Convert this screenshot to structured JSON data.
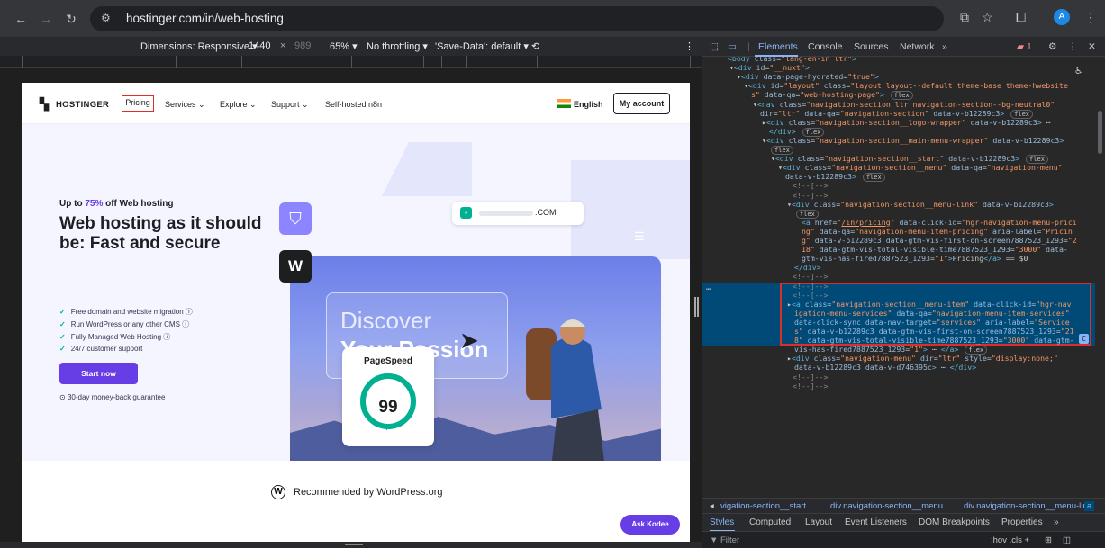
{
  "browser": {
    "url": "hostinger.com/in/web-hosting",
    "avatar_letter": "A"
  },
  "device_toolbar": {
    "dimensions_label": "Dimensions: Responsive ▾",
    "width": "1440",
    "times": "×",
    "height": "989",
    "zoom": "65% ▾",
    "throttle": "No throttling ▾",
    "save_data": "'Save-Data': default ▾"
  },
  "site": {
    "logo_text": "HOSTINGER",
    "nav": {
      "pricing": "Pricing",
      "services": "Services ⌄",
      "explore": "Explore ⌄",
      "support": "Support ⌄",
      "self_hosted": "Self-hosted n8n",
      "language": "English",
      "account": "My account"
    },
    "hero": {
      "offer_prefix": "Up to ",
      "offer_pct": "75%",
      "offer_suffix": " off Web hosting",
      "title": "Web hosting as it should be: Fast and secure",
      "features": [
        "Free domain and website migration ⓘ",
        "Run WordPress or any other CMS ⓘ",
        "Fully Managed Web Hosting ⓘ",
        "24/7 customer support"
      ],
      "cta": "Start now",
      "guarantee": "30-day money-back guarantee",
      "url_suffix": ".COM",
      "discover": "Discover",
      "passion": "Your Passion",
      "pagespeed_label": "PageSpeed",
      "pagespeed_score": "99"
    },
    "recommended": "Recommended by WordPress.org",
    "ask_kodee": "Ask Kodee"
  },
  "devtools": {
    "tabs": [
      "Elements",
      "Console",
      "Sources",
      "Network",
      "»"
    ],
    "issues_count": "1",
    "tree_lines": [
      {
        "indent": 28,
        "html": "<span class='tag'>&lt;body</span> <span class='an'>class</span>=<span class='av'>\"lang-en-in ltr\"</span><span class='tag'>&gt;</span>"
      },
      {
        "indent": 30,
        "html": "▾<span class='tag'>&lt;div</span> <span class='an'>id</span>=<span class='av'>\"__nuxt\"</span><span class='tag'>&gt;</span>"
      },
      {
        "indent": 38,
        "html": "▾<span class='tag'>&lt;div</span> <span class='an'>data-page-hydrated</span>=<span class='av'>\"true\"</span><span class='tag'>&gt;</span>"
      },
      {
        "indent": 46,
        "html": "▾<span class='tag'>&lt;div</span> <span class='an'>id</span>=<span class='av'>\"layout\"</span> <span class='an'>class</span>=<span class='av'>\"layout layout--default theme-base theme-hwebsite</span>"
      },
      {
        "indent": 54,
        "html": "<span class='av'>s\"</span> <span class='an'>data-qa</span>=<span class='av'>\"web-hosting-page\"</span><span class='tag'>&gt;</span> <span class='badge'>flex</span>"
      },
      {
        "indent": 56,
        "html": "▾<span class='tag'>&lt;nav</span> <span class='an'>class</span>=<span class='av'>\"navigation-section ltr navigation-section--bg-neutral0\"</span>"
      },
      {
        "indent": 64,
        "html": "<span class='an'>dir</span>=<span class='av'>\"ltr\"</span> <span class='an'>data-qa</span>=<span class='av'>\"navigation-section\"</span> <span class='an'>data-v-b12289c3</span><span class='tag'>&gt;</span> <span class='badge'>flex</span>"
      },
      {
        "indent": 66,
        "html": "▸<span class='tag'>&lt;div</span> <span class='an'>class</span>=<span class='av'>\"navigation-section__logo-wrapper\"</span> <span class='an'>data-v-b12289c3</span><span class='tag'>&gt;</span> ⋯"
      },
      {
        "indent": 74,
        "html": "<span class='tag'>&lt;/div&gt;</span> <span class='badge'>flex</span>"
      },
      {
        "indent": 66,
        "html": "▾<span class='tag'>&lt;div</span> <span class='an'>class</span>=<span class='av'>\"navigation-section__main-menu-wrapper\"</span> <span class='an'>data-v-b12289c3</span><span class='tag'>&gt;</span>"
      },
      {
        "indent": 74,
        "html": "<span class='badge'>flex</span>"
      },
      {
        "indent": 76,
        "html": "▾<span class='tag'>&lt;div</span> <span class='an'>class</span>=<span class='av'>\"navigation-section__start\"</span> <span class='an'>data-v-b12289c3</span><span class='tag'>&gt;</span> <span class='badge'>flex</span>"
      },
      {
        "indent": 84,
        "html": "▾<span class='tag'>&lt;div</span> <span class='an'>class</span>=<span class='av'>\"navigation-section__menu\"</span> <span class='an'>data-qa</span>=<span class='av'>\"navigation-menu\"</span>"
      },
      {
        "indent": 92,
        "html": "<span class='an'>data-v-b12289c3</span><span class='tag'>&gt;</span> <span class='badge'>flex</span>"
      },
      {
        "indent": 100,
        "html": "<span class='cm'>&lt;!--[--&gt;</span>"
      },
      {
        "indent": 100,
        "html": "<span class='cm'>&lt;!--]--&gt;</span>"
      },
      {
        "indent": 94,
        "html": "▾<span class='tag'>&lt;div</span> <span class='an'>class</span>=<span class='av'>\"navigation-section__menu-link\"</span> <span class='an'>data-v-b12289c3</span><span class='tag'>&gt;</span>"
      },
      {
        "indent": 102,
        "html": "<span class='badge'>flex</span>"
      },
      {
        "indent": 110,
        "html": "<span class='tag'>&lt;a</span> <span class='an'>href</span>=<span class='av'>\"<u>/in/pricing</u>\"</span> <span class='an'>data-click-id</span>=<span class='av'>\"hgr-navigation-menu-prici</span>"
      },
      {
        "indent": 110,
        "html": "<span class='av'>ng\"</span> <span class='an'>data-qa</span>=<span class='av'>\"navigation-menu-item-pricing\"</span> <span class='an'>aria-label</span>=<span class='av'>\"Pricin</span>"
      },
      {
        "indent": 110,
        "html": "<span class='av'>g\"</span> <span class='an'>data-v-b12289c3</span> <span class='an'>data-gtm-vis-first-on-screen7887523_1293</span>=<span class='av'>\"2</span>"
      },
      {
        "indent": 110,
        "html": "<span class='av'>18\"</span> <span class='an'>data-gtm-vis-total-visible-time7887523_1293</span>=<span class='av'>\"3000\"</span> <span class='an'>data-</span>"
      },
      {
        "indent": 110,
        "html": "<span class='an'>gtm-vis-has-fired7887523_1293</span>=<span class='av'>\"1\"</span><span class='tag'>&gt;</span>Pricing<span class='tag'>&lt;/a&gt;</span> == $0"
      },
      {
        "indent": 102,
        "html": "<span class='tag'>&lt;/div&gt;</span>"
      },
      {
        "indent": 100,
        "html": "<span class='cm'>&lt;!--]--&gt;</span>"
      },
      {
        "indent": 100,
        "html": "<span class='cm'>&lt;!--]--&gt;</span>"
      },
      {
        "indent": 100,
        "html": "<span class='cm'>&lt;!--[--&gt;</span>"
      },
      {
        "indent": 94,
        "html": "▸<span class='tag'>&lt;a</span> <span class='an'>class</span>=<span class='av'>\"navigation-section__menu-item\"</span> <span class='an'>data-click-id</span>=<span class='av'>\"hgr-nav</span>"
      },
      {
        "indent": 102,
        "html": "<span class='av'>igation-menu-services\"</span> <span class='an'>data-qa</span>=<span class='av'>\"navigation-menu-item-services\"</span>"
      },
      {
        "indent": 102,
        "html": "<span class='an'>data-click-sync</span> <span class='an'>data-nav-target</span>=<span class='av'>\"services\"</span> <span class='an'>aria-label</span>=<span class='av'>\"Service</span>"
      },
      {
        "indent": 102,
        "html": "<span class='av'>s\"</span> <span class='an'>data-v-b12289c3</span> <span class='an'>data-gtm-vis-first-on-screen7887523_1293</span>=<span class='av'>\"21</span>"
      },
      {
        "indent": 102,
        "html": "<span class='av'>8\"</span> <span class='an'>data-gtm-vis-total-visible-time7887523_1293</span>=<span class='av'>\"3000\"</span> <span class='an'>data-gtm-</span>"
      },
      {
        "indent": 102,
        "html": "<span class='an'>vis-has-fired7887523_1293</span>=<span class='av'>\"1\"</span><span class='tag'>&gt;</span> ⋯ <span class='tag'>&lt;/a&gt;</span> <span class='badge'>flex</span>"
      },
      {
        "indent": 94,
        "html": "▸<span class='tag'>&lt;div</span> <span class='an'>class</span>=<span class='av'>\"navigation-menu\"</span> <span class='an'>dir</span>=<span class='av'>\"ltr\"</span> <span class='an'>style</span>=<span class='av'>\"display:none;\"</span>"
      },
      {
        "indent": 102,
        "html": "<span class='an'>data-v-b12289c3</span> <span class='an'>data-v-d746395c</span><span class='tag'>&gt;</span> ⋯ <span class='tag'>&lt;/div&gt;</span>"
      },
      {
        "indent": 100,
        "html": "<span class='cm'>&lt;!--]--&gt;</span>"
      },
      {
        "indent": 100,
        "html": "<span class='cm'>&lt;!--]--&gt;</span>"
      }
    ],
    "breadcrumbs": [
      "◂",
      "vigation-section__start",
      "div.navigation-section__menu",
      "div.navigation-section__menu-link",
      "a"
    ],
    "styles_tabs": [
      "Styles",
      "Computed",
      "Layout",
      "Event Listeners",
      "DOM Breakpoints",
      "Properties",
      "»"
    ],
    "filter_placeholder": "Filter",
    "filter_right": ":hov  .cls  +"
  }
}
